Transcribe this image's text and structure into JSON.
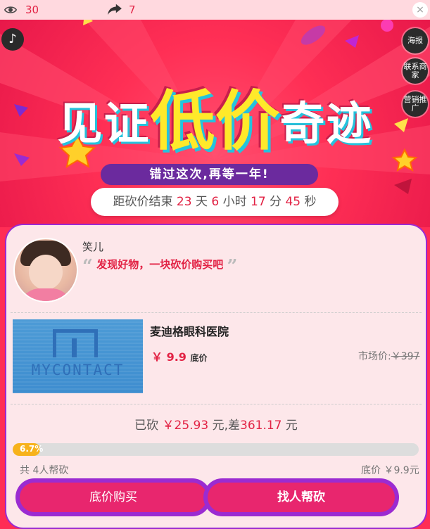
{
  "topbar": {
    "views": "30",
    "shares": "7",
    "close": "×"
  },
  "banner": {
    "headline_left": "见证",
    "headline_mid": "低价",
    "headline_right": "奇迹",
    "ribbon": "错过这次,再等一年!",
    "side_buttons": [
      "海报",
      "联系商家",
      "营销推广"
    ],
    "music_icon": "♪"
  },
  "countdown": {
    "prefix": "距砍价结束",
    "days": "23",
    "days_unit": "天",
    "hours": "6",
    "hours_unit": "小时",
    "minutes": "17",
    "minutes_unit": "分",
    "seconds": "45",
    "seconds_unit": "秒"
  },
  "user": {
    "name": "笑儿",
    "quote": "发现好物，一块砍价购买吧"
  },
  "product": {
    "name": "麦迪格眼科医院",
    "image_brand": "MYCONTACT",
    "price_symbol": "￥",
    "price": "9.9",
    "price_label": "底价",
    "market_label": "市场价:",
    "market_price": "￥397"
  },
  "progress": {
    "cut_label": "已砍",
    "cut_amount": "￥25.93",
    "cut_unit": "元",
    "diff_label": ",差",
    "diff_amount": "361.17",
    "diff_unit": "元",
    "percent_text": "6.7%",
    "percent": 6.7,
    "helpers": "共 4人帮砍",
    "base_price": "底价 ￥9.9元"
  },
  "buttons": {
    "buy": "底价购买",
    "help": "找人帮砍"
  },
  "colors": {
    "accent_red": "#e22244",
    "banner_red": "#ff2f55",
    "purple": "#9b2bd1",
    "progress_yellow": "#f7b21b"
  }
}
